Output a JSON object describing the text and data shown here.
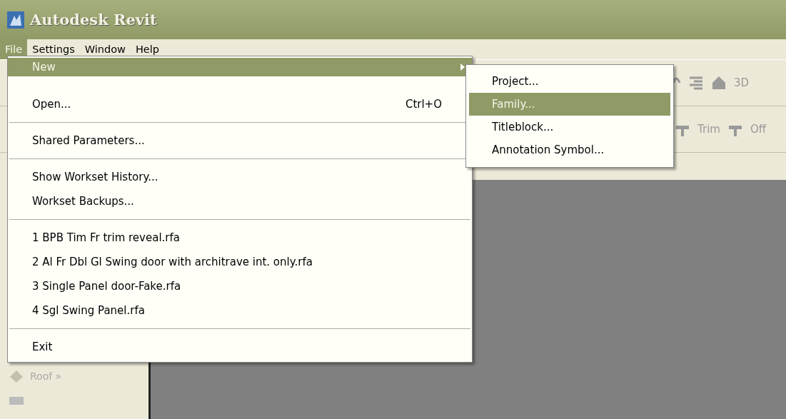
{
  "window": {
    "title": "Autodesk Revit"
  },
  "menubar": [
    {
      "label": "File",
      "selected": true
    },
    {
      "label": "Settings",
      "selected": false
    },
    {
      "label": "Window",
      "selected": false
    },
    {
      "label": "Help",
      "selected": false
    }
  ],
  "file_menu": [
    {
      "kind": "item",
      "label": "New",
      "selected": true,
      "submenu": true
    },
    {
      "kind": "item",
      "label": "Open...",
      "shortcut": "Ctrl+O",
      "selected": false
    },
    {
      "kind": "separator"
    },
    {
      "kind": "item",
      "label": "Shared Parameters...",
      "selected": false
    },
    {
      "kind": "separator"
    },
    {
      "kind": "item",
      "label": "Show Workset History...",
      "selected": false
    },
    {
      "kind": "item",
      "label": "Workset Backups...",
      "selected": false
    },
    {
      "kind": "separator"
    },
    {
      "kind": "item",
      "label": "1 BPB Tim Fr trim reveal.rfa",
      "selected": false
    },
    {
      "kind": "item",
      "label": "2 Al Fr Dbl Gl Swing door with architrave int. only.rfa",
      "selected": false
    },
    {
      "kind": "item",
      "label": "3 Single Panel door-Fake.rfa",
      "selected": false
    },
    {
      "kind": "item",
      "label": "4 Sgl Swing Panel.rfa",
      "selected": false
    },
    {
      "kind": "separator"
    },
    {
      "kind": "item",
      "label": "Exit",
      "selected": false
    }
  ],
  "new_submenu": [
    {
      "label": "Project...",
      "selected": false
    },
    {
      "label": "Family...",
      "selected": true
    },
    {
      "label": "Titleblock...",
      "selected": false
    },
    {
      "label": "Annotation Symbol...",
      "selected": false
    }
  ],
  "toolbar_top": {
    "label": "3D"
  },
  "toolbar_bottom": [
    {
      "label": "Trim"
    },
    {
      "label": "Off"
    }
  ],
  "design_bar": [
    {
      "label": "Roof »"
    }
  ]
}
